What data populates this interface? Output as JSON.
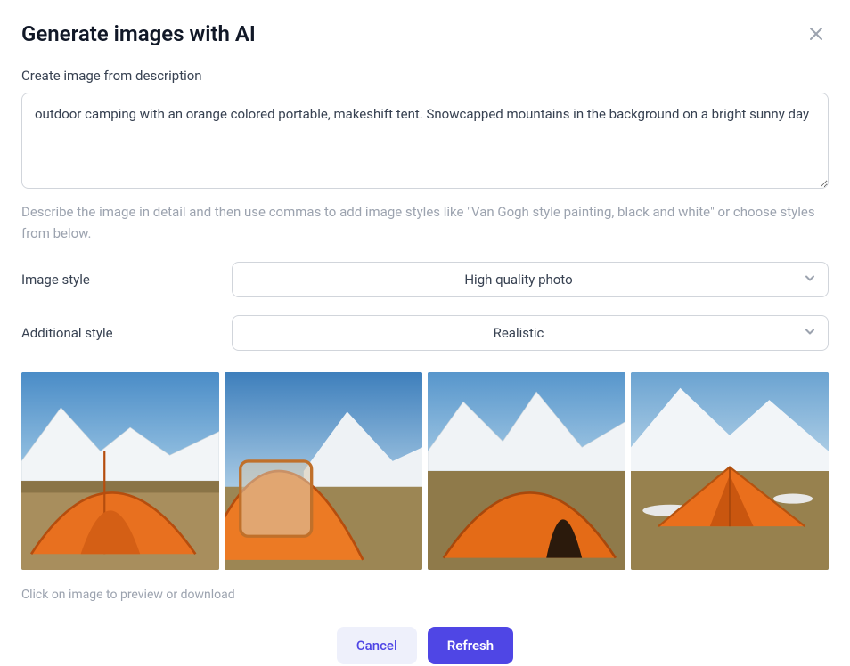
{
  "header": {
    "title": "Generate images with AI"
  },
  "description": {
    "label": "Create image from description",
    "value": "outdoor camping with an orange colored portable, makeshift tent. Snowcapped mountains in the background on a bright sunny day",
    "helper": "Describe the image in detail and then use commas to add image styles like \"Van Gogh style painting, black and white\" or choose styles from below."
  },
  "image_style": {
    "label": "Image style",
    "value": "High quality photo"
  },
  "additional_style": {
    "label": "Additional style",
    "value": "Realistic"
  },
  "images_hint": "Click on image to preview or download",
  "buttons": {
    "cancel": "Cancel",
    "refresh": "Refresh"
  },
  "generated_images": [
    {
      "alt": "orange-tent-mountain-1"
    },
    {
      "alt": "orange-tent-mountain-2"
    },
    {
      "alt": "orange-tent-mountain-3"
    },
    {
      "alt": "orange-tent-mountain-4"
    }
  ],
  "colors": {
    "accent": "#4f46e5",
    "accent_light": "#eef0fb",
    "text_muted": "#9ca3af"
  }
}
